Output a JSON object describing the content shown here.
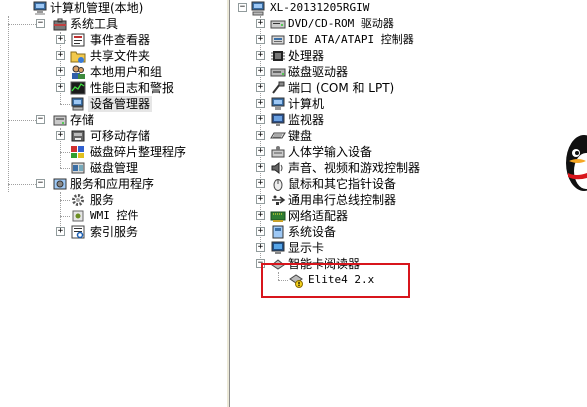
{
  "left_tree": {
    "root": "计算机管理(本地)",
    "items": [
      {
        "label": "系统工具"
      },
      {
        "label": "事件查看器"
      },
      {
        "label": "共享文件夹"
      },
      {
        "label": "本地用户和组"
      },
      {
        "label": "性能日志和警报"
      },
      {
        "label": "设备管理器"
      },
      {
        "label": "存储"
      },
      {
        "label": "可移动存储"
      },
      {
        "label": "磁盘碎片整理程序"
      },
      {
        "label": "磁盘管理"
      },
      {
        "label": "服务和应用程序"
      },
      {
        "label": "服务"
      },
      {
        "label": "WMI 控件"
      },
      {
        "label": "索引服务"
      }
    ]
  },
  "right_tree": {
    "root": "XL-20131205RGIW",
    "categories": [
      {
        "label": "DVD/CD-ROM 驱动器"
      },
      {
        "label": "IDE ATA/ATAPI 控制器"
      },
      {
        "label": "处理器"
      },
      {
        "label": "磁盘驱动器"
      },
      {
        "label": "端口 (COM 和 LPT)"
      },
      {
        "label": "计算机"
      },
      {
        "label": "监视器"
      },
      {
        "label": "键盘"
      },
      {
        "label": "人体学输入设备"
      },
      {
        "label": "声音、视频和游戏控制器"
      },
      {
        "label": "鼠标和其它指针设备"
      },
      {
        "label": "通用串行总线控制器"
      },
      {
        "label": "网络适配器"
      },
      {
        "label": "系统设备"
      },
      {
        "label": "显示卡"
      },
      {
        "label": "智能卡阅读器"
      }
    ],
    "device": "Elite4 2.x"
  },
  "colors": {
    "highlight_box": "#d8151c",
    "warning": "#f5d21b"
  }
}
